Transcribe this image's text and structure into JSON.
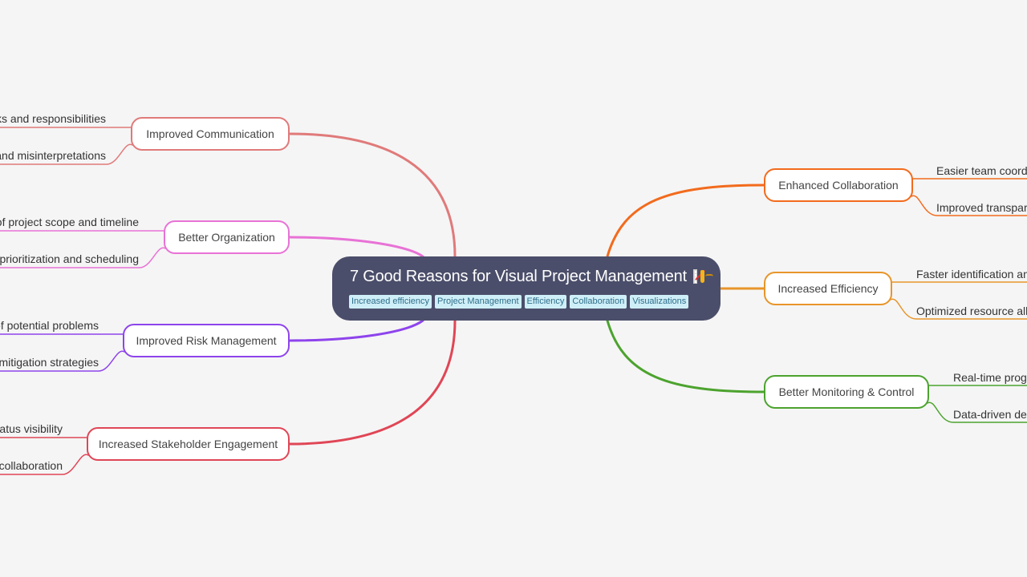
{
  "mindmap": {
    "root": {
      "title": "7 Good Reasons for Visual Project Management",
      "emoji_icons": [
        "chart-increasing-icon",
        "handshake-icon"
      ],
      "tags": [
        "Increased efficiency",
        "Project Management",
        "Efficiency",
        "Collaboration",
        "Visualizations"
      ],
      "background_color": "#4b4e6a",
      "tag_color": "#cfeff8"
    },
    "branches": [
      {
        "label": "Improved Communication",
        "side": "left",
        "color": "#e07a7a",
        "children": [
          "ks and responsibilities",
          "and misinterpretations"
        ]
      },
      {
        "label": "Better Organization",
        "side": "left",
        "color": "#e872d6",
        "children": [
          "of project scope and timeline",
          "prioritization and scheduling"
        ]
      },
      {
        "label": "Improved Risk Management",
        "side": "left",
        "color": "#8e44ec",
        "children": [
          "of potential problems",
          "mitigation strategies"
        ]
      },
      {
        "label": "Increased Stakeholder Engagement",
        "side": "left",
        "color": "#e04656",
        "children": [
          "atus visibility",
          "collaboration"
        ]
      },
      {
        "label": "Enhanced Collaboration",
        "side": "right",
        "color": "#f26b1d",
        "children": [
          "Easier team coordi",
          "Improved transpar"
        ]
      },
      {
        "label": "Increased Efficiency",
        "side": "right",
        "color": "#e8952a",
        "children": [
          "Faster identification an",
          "Optimized resource allo"
        ]
      },
      {
        "label": "Better Monitoring & Control",
        "side": "right",
        "color": "#4ca32e",
        "children": [
          "Real-time progr",
          "Data-driven dec"
        ]
      }
    ]
  }
}
